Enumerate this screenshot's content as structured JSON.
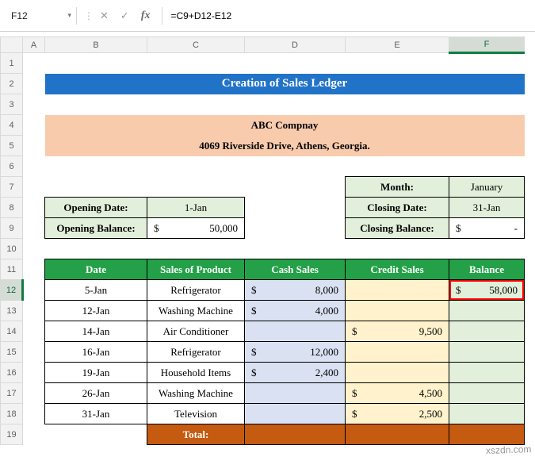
{
  "formula_bar": {
    "name_box": "F12",
    "caret_icon": "▾",
    "dots_icon": "⋮",
    "cancel_icon": "✕",
    "enter_icon": "✓",
    "fx_icon": "fx",
    "formula": "=C9+D12-E12"
  },
  "grid": {
    "columns": [
      "A",
      "B",
      "C",
      "D",
      "E",
      "F"
    ],
    "row_numbers": [
      "1",
      "2",
      "3",
      "4",
      "5",
      "6",
      "7",
      "8",
      "9",
      "10",
      "11",
      "12",
      "13",
      "14",
      "15",
      "16",
      "17",
      "18",
      "19"
    ]
  },
  "sheet": {
    "title": "Creation of Sales Ledger",
    "company_name": "ABC Compnay",
    "company_address": "4069 Riverside Drive, Athens, Georgia.",
    "month_label": "Month:",
    "month_value": "January",
    "opening_date_label": "Opening Date:",
    "opening_date_value": "1-Jan",
    "opening_balance_label": "Opening Balance:",
    "opening_balance_dollar": "$",
    "opening_balance_value": "50,000",
    "closing_date_label": "Closing Date:",
    "closing_date_value": "31-Jan",
    "closing_balance_label": "Closing Balance:",
    "closing_balance_dollar": "$",
    "closing_balance_value": "-"
  },
  "ledger": {
    "headers": {
      "date": "Date",
      "product": "Sales of Product",
      "cash": "Cash Sales",
      "credit": "Credit Sales",
      "balance": "Balance"
    },
    "rows": [
      {
        "date": "5-Jan",
        "product": "Refrigerator",
        "cash_dollar": "$",
        "cash": "8,000",
        "credit_dollar": "",
        "credit": "",
        "balance_dollar": "$",
        "balance": "58,000"
      },
      {
        "date": "12-Jan",
        "product": "Washing Machine",
        "cash_dollar": "$",
        "cash": "4,000",
        "credit_dollar": "",
        "credit": "",
        "balance_dollar": "",
        "balance": ""
      },
      {
        "date": "14-Jan",
        "product": "Air Conditioner",
        "cash_dollar": "",
        "cash": "",
        "credit_dollar": "$",
        "credit": "9,500",
        "balance_dollar": "",
        "balance": ""
      },
      {
        "date": "16-Jan",
        "product": "Refrigerator",
        "cash_dollar": "$",
        "cash": "12,000",
        "credit_dollar": "",
        "credit": "",
        "balance_dollar": "",
        "balance": ""
      },
      {
        "date": "19-Jan",
        "product": "Household Items",
        "cash_dollar": "$",
        "cash": "2,400",
        "credit_dollar": "",
        "credit": "",
        "balance_dollar": "",
        "balance": ""
      },
      {
        "date": "26-Jan",
        "product": "Washing Machine",
        "cash_dollar": "",
        "cash": "",
        "credit_dollar": "$",
        "credit": "4,500",
        "balance_dollar": "",
        "balance": ""
      },
      {
        "date": "31-Jan",
        "product": "Television",
        "cash_dollar": "",
        "cash": "",
        "credit_dollar": "$",
        "credit": "2,500",
        "balance_dollar": "",
        "balance": ""
      }
    ],
    "total_label": "Total:"
  },
  "watermark": "xszdn.com",
  "colors": {
    "title_banner_bg": "#2173C8",
    "company_bg": "#F8CBAD",
    "ledger_header_bg": "#24A148",
    "total_row_bg": "#C55A11",
    "cash_cell_bg": "#D9E1F2",
    "credit_cell_bg": "#FFF2CC",
    "balance_cell_bg": "#E2EFDA",
    "label_cell_bg": "#E2EFDA",
    "selection_border": "#FF0000",
    "header_accent_green": "#107C41"
  }
}
